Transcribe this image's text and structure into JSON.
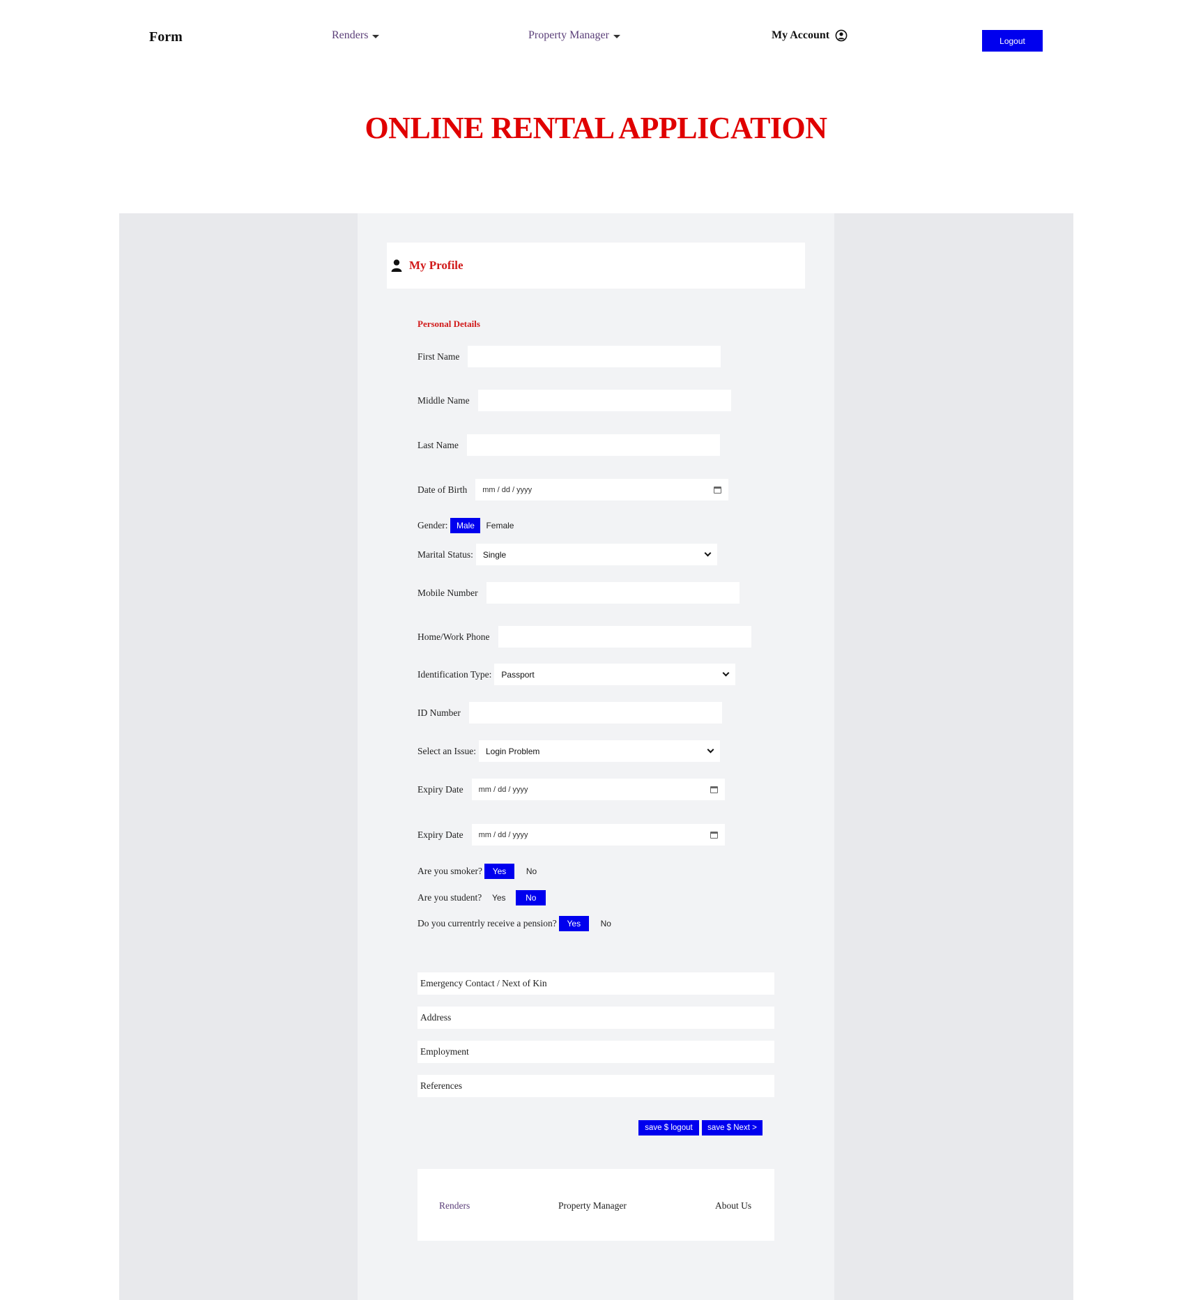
{
  "nav": {
    "brand": "Form",
    "renders": "Renders",
    "property_manager": "Property Manager",
    "my_account": "My Account",
    "logout": "Logout"
  },
  "title": "ONLINE RENTAL APPLICATION",
  "profile": {
    "heading": "My Profile",
    "icon": "user-icon"
  },
  "personal_details": {
    "heading": "Personal Details",
    "first_name_label": "First Name",
    "first_name_value": "",
    "middle_name_label": "Middle Name",
    "middle_name_value": "",
    "last_name_label": "Last Name",
    "last_name_value": "",
    "dob_label": "Date of Birth",
    "dob_placeholder": "mm / dd / yyyy",
    "gender_label": "Gender:",
    "gender_options": [
      "Male",
      "Female"
    ],
    "gender_selected": "Male",
    "marital_label": "Marital Status:",
    "marital_value": "Single",
    "mobile_label": "Mobile Number",
    "home_phone_label": "Home/Work Phone",
    "id_type_label": "Identification Type:",
    "id_type_value": "Passport",
    "id_number_label": "ID Number",
    "issue_label": "Select an Issue:",
    "issue_value": "Login Problem",
    "expiry1_label": "Expiry Date",
    "expiry1_placeholder": "mm / dd / yyyy",
    "expiry2_label": "Expiry Date",
    "expiry2_placeholder": "mm / dd / yyyy",
    "smoker_label": "Are you smoker?",
    "smoker_selected": "Yes",
    "student_label": "Are you student?",
    "student_selected": "No",
    "pension_label": "Do you currentrly receive a pension?",
    "pension_selected": "Yes",
    "yes": "Yes",
    "no": "No"
  },
  "sections": [
    "Emergency Contact / Next of Kin",
    "Address",
    "Employment",
    "References"
  ],
  "actions": {
    "save_logout": "save $ logout",
    "save_next": "save $ Next >"
  },
  "footer": {
    "renders": "Renders",
    "property_manager": "Property Manager",
    "about": "About Us"
  },
  "colors": {
    "accent": "#0000ee",
    "title_red": "#e00000",
    "link_purple": "#5b3f79"
  }
}
